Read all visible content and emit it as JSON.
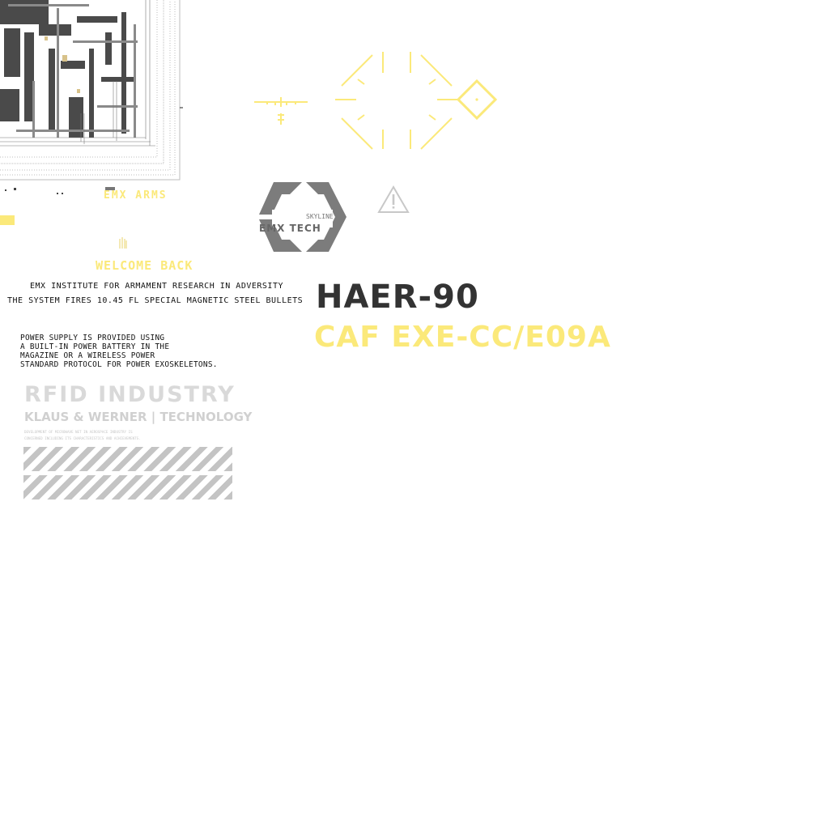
{
  "brand": {
    "emx_arms": "EMX ARMS",
    "logo_small": "SKYLINE",
    "logo_main": "EMX TECH"
  },
  "intro": {
    "welcome": "WELCOME BACK",
    "institute": "EMX INSTITUTE FOR ARMAMENT RESEARCH IN ADVERSITY",
    "system_fires": "THE SYSTEM FIRES 10.45 FL SPECIAL MAGNETIC STEEL BULLETS"
  },
  "power": {
    "text": "POWER SUPPLY IS PROVIDED USING\nA BUILT-IN POWER BATTERY IN THE\nMAGAZINE OR A WIRELESS POWER\nSTANDARD PROTOCOL FOR POWER EXOSKELETONS."
  },
  "model": {
    "name": "HAER-90",
    "code": "CAF EXE-CC/E09A"
  },
  "rfid": {
    "title": "RFID INDUSTRY",
    "subtitle": "KLAUS & WERNER | TECHNOLOGY",
    "fine_print": "DEVELOPMENT OF MICROWAVE NET IN AEROSPACE INDUSTRY IS\nCONCERNED INCLUDING ITS CHARACTERISTICS AND ACHIEVEMENTS."
  },
  "colors": {
    "accent_yellow": "#fbe97a",
    "dark": "#333333",
    "light_grey": "#d0d0d0"
  },
  "icons": [
    "circuit-board-graphic",
    "crosshair-reticle-icon",
    "diamond-target-icon",
    "warning-triangle-icon",
    "emx-tech-logo"
  ]
}
